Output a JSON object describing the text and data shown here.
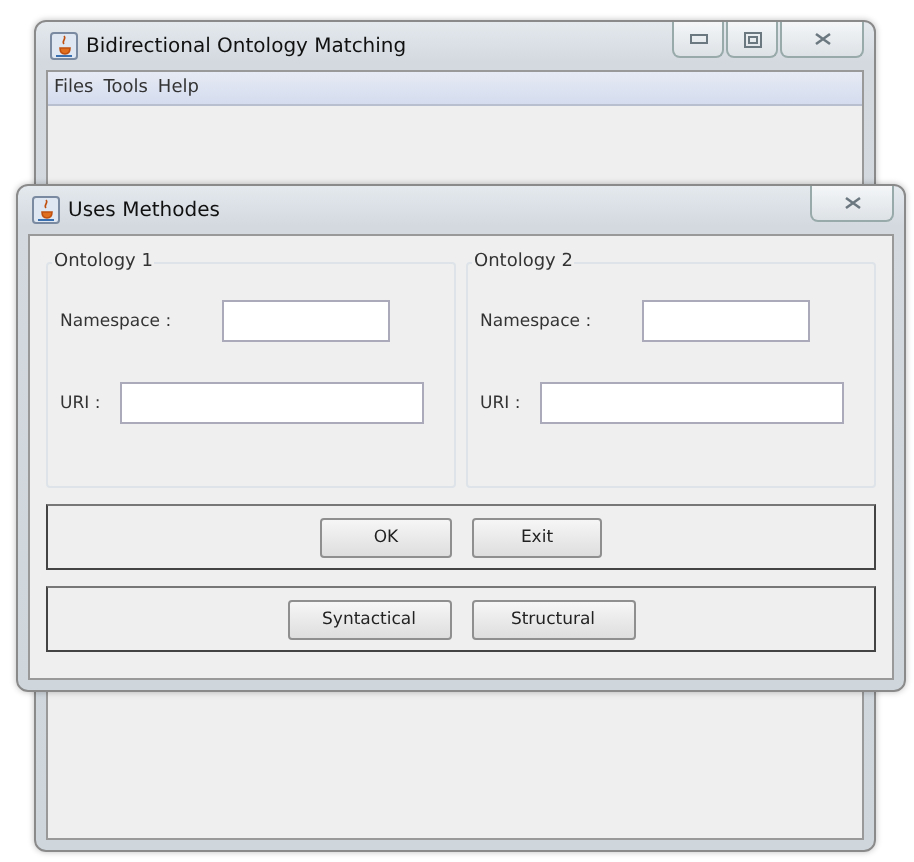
{
  "main_window": {
    "title": "Bidirectional Ontology Matching",
    "menu": [
      "Files",
      "Tools",
      "Help"
    ]
  },
  "dialog": {
    "title": "Uses Methodes",
    "ontologies": [
      {
        "title": "Ontology 1",
        "namespace_label": "Namespace :",
        "uri_label": "URI :"
      },
      {
        "title": "Ontology 2",
        "namespace_label": "Namespace :",
        "uri_label": "URI :"
      }
    ],
    "action_buttons": [
      "OK",
      "Exit"
    ],
    "method_buttons": [
      "Syntactical",
      "Structural"
    ]
  }
}
